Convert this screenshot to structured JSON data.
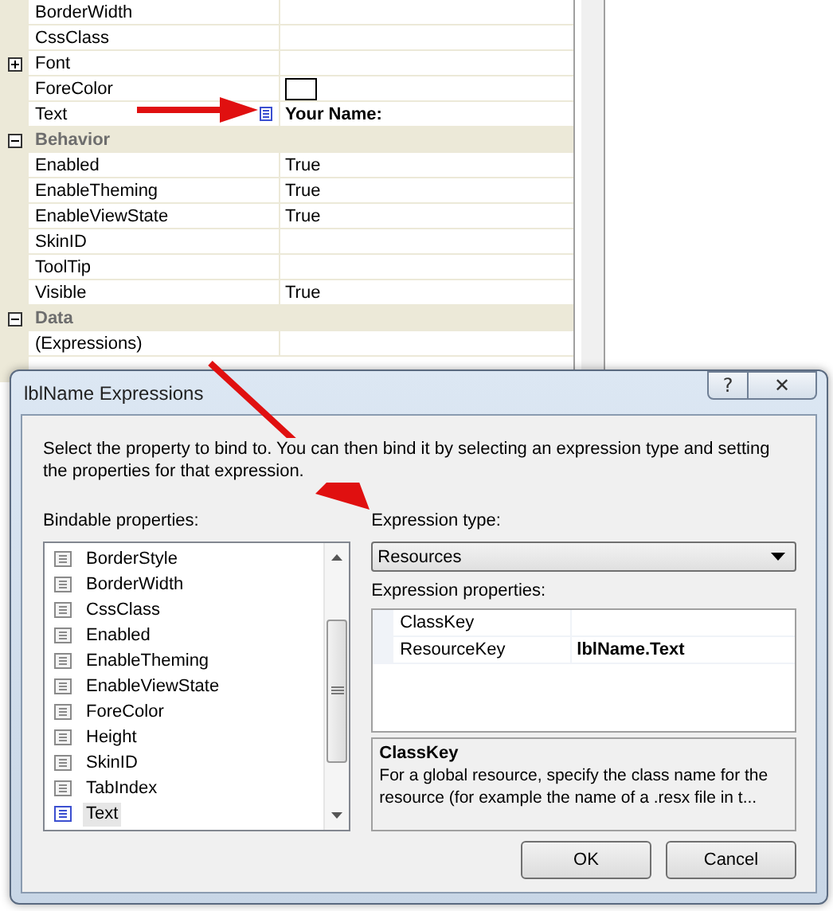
{
  "property_grid": {
    "rows": [
      {
        "kind": "property",
        "name": "BorderWidth"
      },
      {
        "kind": "property",
        "name": "CssClass"
      },
      {
        "kind": "group",
        "name": "Font",
        "expanded": false
      },
      {
        "kind": "color",
        "name": "ForeColor"
      },
      {
        "kind": "bound",
        "name": "Text",
        "value": "Your Name:"
      },
      {
        "kind": "category",
        "name": "Behavior",
        "expanded": true
      },
      {
        "kind": "property",
        "name": "Enabled",
        "value": "True"
      },
      {
        "kind": "property",
        "name": "EnableTheming",
        "value": "True"
      },
      {
        "kind": "property",
        "name": "EnableViewState",
        "value": "True"
      },
      {
        "kind": "property",
        "name": "SkinID"
      },
      {
        "kind": "property",
        "name": "ToolTip"
      },
      {
        "kind": "property",
        "name": "Visible",
        "value": "True"
      },
      {
        "kind": "category",
        "name": "Data",
        "expanded": true
      },
      {
        "kind": "property",
        "name": "(Expressions)"
      }
    ]
  },
  "dialog": {
    "title": "lblName Expressions",
    "help_button": "?",
    "close_button": "✕",
    "description": "Select the property to bind to. You can then bind it by selecting an expression type and setting the properties for that expression.",
    "bindable_label": "Bindable properties:",
    "bindable_properties": [
      {
        "name": "BorderStyle",
        "selected": false,
        "bound": false
      },
      {
        "name": "BorderWidth",
        "selected": false,
        "bound": false
      },
      {
        "name": "CssClass",
        "selected": false,
        "bound": false
      },
      {
        "name": "Enabled",
        "selected": false,
        "bound": false
      },
      {
        "name": "EnableTheming",
        "selected": false,
        "bound": false
      },
      {
        "name": "EnableViewState",
        "selected": false,
        "bound": false
      },
      {
        "name": "ForeColor",
        "selected": false,
        "bound": false
      },
      {
        "name": "Height",
        "selected": false,
        "bound": false
      },
      {
        "name": "SkinID",
        "selected": false,
        "bound": false
      },
      {
        "name": "TabIndex",
        "selected": false,
        "bound": false
      },
      {
        "name": "Text",
        "selected": true,
        "bound": true
      }
    ],
    "expression_type_label": "Expression type:",
    "expression_type": "Resources",
    "expression_properties_label": "Expression properties:",
    "expression_properties": [
      {
        "name": "ClassKey"
      },
      {
        "name": "ResourceKey",
        "value": "lblName.Text"
      }
    ],
    "help_title": "ClassKey",
    "help_text": "For a global resource, specify the class name for the resource (for example the name of a .resx file in t...",
    "buttons": [
      "OK",
      "Cancel"
    ]
  }
}
